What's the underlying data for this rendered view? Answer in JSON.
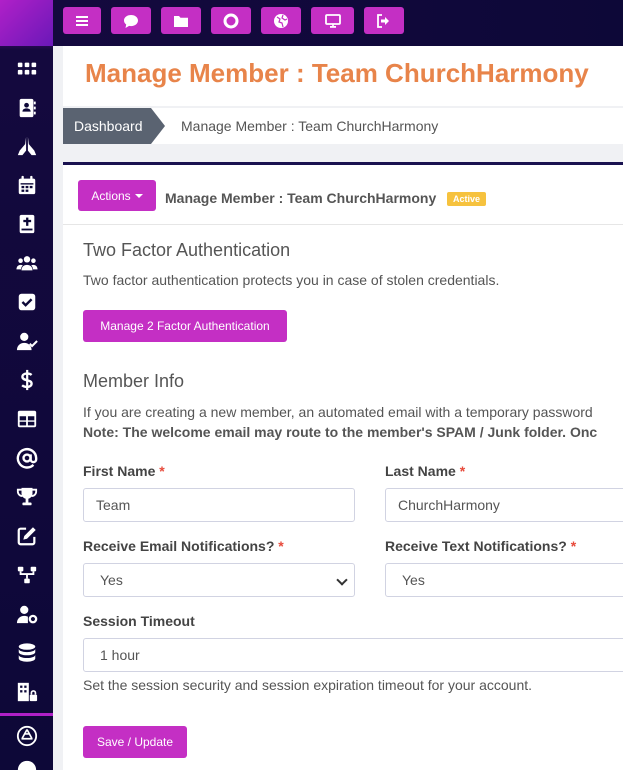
{
  "topbar": {
    "buttons": [
      {
        "icon": "menu-icon"
      },
      {
        "icon": "chat-icon"
      },
      {
        "icon": "folder-icon"
      },
      {
        "icon": "lifebuoy-icon"
      },
      {
        "icon": "globe-icon"
      },
      {
        "icon": "monitor-icon"
      },
      {
        "icon": "sign-out-icon"
      }
    ]
  },
  "sidebar": {
    "icons": [
      "grid-icon",
      "address-book-icon",
      "praying-hands-icon",
      "calendar-icon",
      "bible-icon",
      "users-icon",
      "check-square-icon",
      "user-check-icon",
      "dollar-icon",
      "table-icon",
      "at-icon",
      "trophy-icon",
      "edit-icon",
      "network-icon",
      "user-cog-icon",
      "database-icon",
      "building-lock-icon",
      "app-store-icon"
    ]
  },
  "page": {
    "title": "Manage Member : Team ChurchHarmony"
  },
  "breadcrumb": {
    "home": "Dashboard",
    "current": "Manage Member : Team ChurchHarmony"
  },
  "card": {
    "actions_label": "Actions",
    "title": "Manage Member : Team ChurchHarmony",
    "status": "Active"
  },
  "two_factor": {
    "heading": "Two Factor Authentication",
    "description": "Two factor authentication protects you in case of stolen credentials.",
    "button": "Manage 2 Factor Authentication"
  },
  "member_info": {
    "heading": "Member Info",
    "description": "If you are creating a new member, an automated email with a temporary password",
    "note": "Note: The welcome email may route to the member's SPAM / Junk folder. Onc"
  },
  "form": {
    "first_name": {
      "label": "First Name",
      "value": "Team"
    },
    "last_name": {
      "label": "Last Name",
      "value": "ChurchHarmony"
    },
    "email_notif": {
      "label": "Receive Email Notifications?",
      "value": "Yes"
    },
    "text_notif": {
      "label": "Receive Text Notifications?",
      "value": "Yes"
    },
    "session_timeout": {
      "label": "Session Timeout",
      "value": "1 hour",
      "help": "Set the session security and session expiration timeout for your account."
    },
    "required_mark": "*",
    "save_label": "Save / Update"
  },
  "colors": {
    "accent": "#c42fc4",
    "title": "#e8844a",
    "sidebar": "#0d0838",
    "badge": "#f6c23e"
  }
}
